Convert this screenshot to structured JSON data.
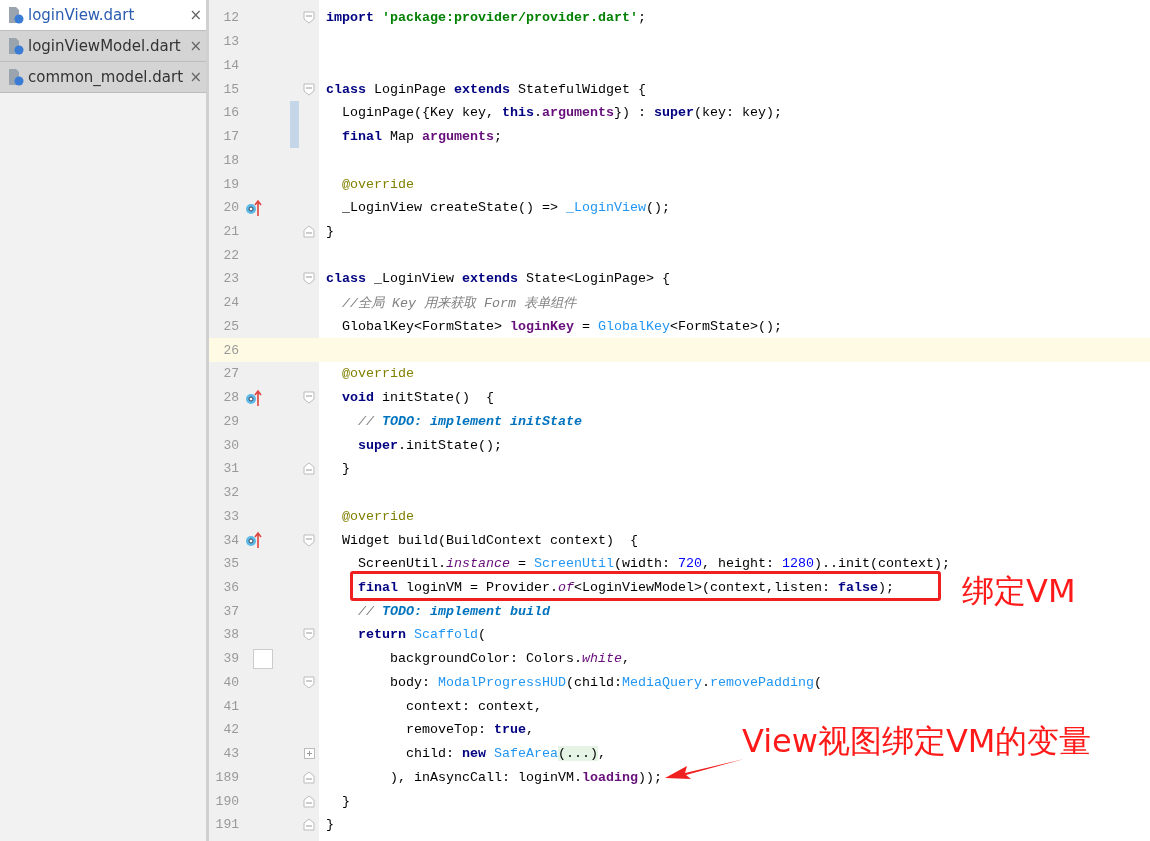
{
  "file_tabs": [
    {
      "label": "loginView.dart",
      "close": "×",
      "selected": true
    },
    {
      "label": "loginViewModel.dart",
      "close": "×",
      "selected": false
    },
    {
      "label": "common_model.dart",
      "close": "×",
      "selected": false
    }
  ],
  "editor": {
    "lines": [
      {
        "number": "12",
        "fold": {
          "kind": "open"
        },
        "tokens": [
          {
            "kind": "keyword",
            "text": "import"
          },
          {
            "kind": "string",
            "text": " 'package:provider/provider.dart'"
          },
          {
            "kind": "plain",
            "text": ";"
          }
        ]
      },
      {
        "number": "13"
      },
      {
        "number": "14"
      },
      {
        "number": "15",
        "fold": {
          "kind": "open"
        },
        "tokens": [
          {
            "kind": "keyword",
            "text": "class"
          },
          {
            "kind": "plain",
            "text": " LoginPage "
          },
          {
            "kind": "keyword",
            "text": "extends"
          },
          {
            "kind": "plain",
            "text": " StatefulWidget {"
          }
        ]
      },
      {
        "number": "16",
        "changed": true,
        "tokens": [
          {
            "kind": "plain",
            "text": "  LoginPage({Key key, "
          },
          {
            "kind": "keyword",
            "text": "this"
          },
          {
            "kind": "plain",
            "text": "."
          },
          {
            "kind": "field",
            "text": "arguments"
          },
          {
            "kind": "plain",
            "text": "}) : "
          },
          {
            "kind": "keyword",
            "text": "super"
          },
          {
            "kind": "plain",
            "text": "(key: key);"
          }
        ]
      },
      {
        "number": "17",
        "changed": true,
        "tokens": [
          {
            "kind": "keyword",
            "text": "  final"
          },
          {
            "kind": "plain",
            "text": " Map "
          },
          {
            "kind": "field",
            "text": "arguments"
          },
          {
            "kind": "plain",
            "text": ";"
          }
        ]
      },
      {
        "number": "18"
      },
      {
        "number": "19",
        "tokens": [
          {
            "kind": "annotation",
            "text": "  @override"
          }
        ]
      },
      {
        "number": "20",
        "marker": {
          "kind": "override"
        },
        "tokens": [
          {
            "kind": "plain",
            "text": "  _LoginView createState() => "
          },
          {
            "kind": "type",
            "text": "_LoginView"
          },
          {
            "kind": "plain",
            "text": "();"
          }
        ]
      },
      {
        "number": "21",
        "fold": {
          "kind": "close"
        },
        "tokens": [
          {
            "kind": "plain",
            "text": "}"
          }
        ]
      },
      {
        "number": "22"
      },
      {
        "number": "23",
        "fold": {
          "kind": "open"
        },
        "tokens": [
          {
            "kind": "keyword",
            "text": "class"
          },
          {
            "kind": "plain",
            "text": " _LoginView "
          },
          {
            "kind": "keyword",
            "text": "extends"
          },
          {
            "kind": "plain",
            "text": " State<LoginPage> {"
          }
        ]
      },
      {
        "number": "24",
        "tokens": [
          {
            "kind": "comment",
            "text": "  //全局 Key 用来获取 Form 表单组件"
          }
        ]
      },
      {
        "number": "25",
        "tokens": [
          {
            "kind": "plain",
            "text": "  GlobalKey<FormState> "
          },
          {
            "kind": "field",
            "text": "loginKey"
          },
          {
            "kind": "plain",
            "text": " = "
          },
          {
            "kind": "type",
            "text": "GlobalKey"
          },
          {
            "kind": "plain",
            "text": "<FormState>();"
          }
        ]
      },
      {
        "number": "26",
        "current": true
      },
      {
        "number": "27",
        "tokens": [
          {
            "kind": "annotation",
            "text": "  @override"
          }
        ]
      },
      {
        "number": "28",
        "marker": {
          "kind": "override"
        },
        "fold": {
          "kind": "open"
        },
        "tokens": [
          {
            "kind": "keyword",
            "text": "  void"
          },
          {
            "kind": "plain",
            "text": " initState()  {"
          }
        ]
      },
      {
        "number": "29",
        "tokens": [
          {
            "kind": "comment",
            "text": "    //"
          },
          {
            "kind": "todo",
            "text": " TODO: implement initState"
          }
        ]
      },
      {
        "number": "30",
        "tokens": [
          {
            "kind": "keyword",
            "text": "    super"
          },
          {
            "kind": "plain",
            "text": ".initState();"
          }
        ]
      },
      {
        "number": "31",
        "fold": {
          "kind": "close"
        },
        "tokens": [
          {
            "kind": "plain",
            "text": "  }"
          }
        ]
      },
      {
        "number": "32"
      },
      {
        "number": "33",
        "tokens": [
          {
            "kind": "annotation",
            "text": "  @override"
          }
        ]
      },
      {
        "number": "34",
        "marker": {
          "kind": "override"
        },
        "fold": {
          "kind": "open"
        },
        "tokens": [
          {
            "kind": "plain",
            "text": "  Widget build(BuildContext context)  {"
          }
        ]
      },
      {
        "number": "35",
        "tokens": [
          {
            "kind": "plain",
            "text": "    ScreenUtil."
          },
          {
            "kind": "static",
            "text": "instance"
          },
          {
            "kind": "plain",
            "text": " = "
          },
          {
            "kind": "type",
            "text": "ScreenUtil"
          },
          {
            "kind": "plain",
            "text": "(width: "
          },
          {
            "kind": "number",
            "text": "720"
          },
          {
            "kind": "plain",
            "text": ", height: "
          },
          {
            "kind": "number",
            "text": "1280"
          },
          {
            "kind": "plain",
            "text": ")..init(context);"
          }
        ]
      },
      {
        "number": "36",
        "boxed": true,
        "tokens": [
          {
            "kind": "keyword",
            "text": "    final"
          },
          {
            "kind": "plain",
            "text": " loginVM = Provider."
          },
          {
            "kind": "static",
            "text": "of"
          },
          {
            "kind": "plain",
            "text": "<LoginViewModel>(context,listen: "
          },
          {
            "kind": "keyword",
            "text": "false"
          },
          {
            "kind": "plain",
            "text": ");"
          }
        ]
      },
      {
        "number": "37",
        "tokens": [
          {
            "kind": "comment",
            "text": "    //"
          },
          {
            "kind": "todo",
            "text": " TODO: implement build"
          }
        ]
      },
      {
        "number": "38",
        "fold": {
          "kind": "open"
        },
        "tokens": [
          {
            "kind": "keyword",
            "text": "    return"
          },
          {
            "kind": "type",
            "text": " Scaffold"
          },
          {
            "kind": "plain",
            "text": "("
          }
        ]
      },
      {
        "number": "39",
        "marker": {
          "kind": "swatch"
        },
        "tokens": [
          {
            "kind": "plain",
            "text": "        backgroundColor: Colors."
          },
          {
            "kind": "static",
            "text": "white"
          },
          {
            "kind": "plain",
            "text": ","
          }
        ]
      },
      {
        "number": "40",
        "fold": {
          "kind": "open"
        },
        "tokens": [
          {
            "kind": "plain",
            "text": "        body: "
          },
          {
            "kind": "type",
            "text": "ModalProgressHUD"
          },
          {
            "kind": "plain",
            "text": "(child:"
          },
          {
            "kind": "type",
            "text": "MediaQuery"
          },
          {
            "kind": "plain",
            "text": "."
          },
          {
            "kind": "type",
            "text": "removePadding"
          },
          {
            "kind": "plain",
            "text": "("
          }
        ]
      },
      {
        "number": "41",
        "tokens": [
          {
            "kind": "plain",
            "text": "          context: context,"
          }
        ]
      },
      {
        "number": "42",
        "tokens": [
          {
            "kind": "plain",
            "text": "          removeTop: "
          },
          {
            "kind": "keyword",
            "text": "true"
          },
          {
            "kind": "plain",
            "text": ","
          }
        ]
      },
      {
        "number": "43",
        "fold": {
          "kind": "plus"
        },
        "tokens": [
          {
            "kind": "plain",
            "text": "          child: "
          },
          {
            "kind": "keyword",
            "text": "new"
          },
          {
            "kind": "type",
            "text": " SafeArea"
          },
          {
            "kind": "folded",
            "text": "(...)"
          },
          {
            "kind": "plain",
            "text": ","
          }
        ]
      },
      {
        "number": "189",
        "fold": {
          "kind": "close"
        },
        "tokens": [
          {
            "kind": "plain",
            "text": "        ), inAsyncCall: loginVM."
          },
          {
            "kind": "field",
            "text": "loading"
          },
          {
            "kind": "plain",
            "text": "));"
          }
        ]
      },
      {
        "number": "190",
        "fold": {
          "kind": "close"
        },
        "tokens": [
          {
            "kind": "plain",
            "text": "  }"
          }
        ]
      },
      {
        "number": "191",
        "fold": {
          "kind": "close"
        },
        "tokens": [
          {
            "kind": "plain",
            "text": "}"
          }
        ]
      }
    ]
  },
  "callouts": [
    {
      "kind": "label",
      "text": "绑定VM"
    },
    {
      "kind": "arrow",
      "text": "View视图绑定VM的变量"
    }
  ]
}
